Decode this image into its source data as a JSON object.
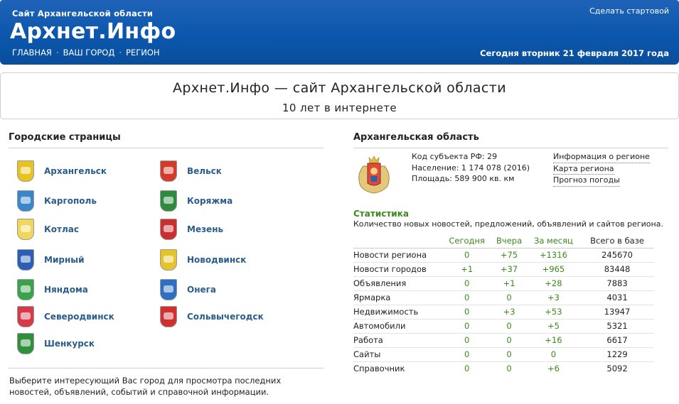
{
  "header": {
    "site_subtitle": "Сайт Архангельской области",
    "site_title": "Архнет.Инфо",
    "nav": [
      "ГЛАВНАЯ",
      "ВАШ ГОРОД",
      "РЕГИОН"
    ],
    "nav_sep": "·",
    "make_start": "Сделать стартовой",
    "today": "Сегодня вторник 21 февраля 2017 года"
  },
  "banner": {
    "title": "Архнет.Инфо — сайт Архангельской области",
    "subtitle": "10 лет в интернете"
  },
  "cities": {
    "title": "Городские страницы",
    "left": [
      {
        "name": "Архангельск",
        "icon": "arkhangelsk-crest-icon",
        "color": "#e8c21f"
      },
      {
        "name": "Каргополь",
        "icon": "kargopol-crest-icon",
        "color": "#3b86c8"
      },
      {
        "name": "Котлас",
        "icon": "kotlas-crest-icon",
        "color": "#f0d65a"
      },
      {
        "name": "Мирный",
        "icon": "mirny-crest-icon",
        "color": "#2a5fb5"
      },
      {
        "name": "Няндома",
        "icon": "nyandoma-crest-icon",
        "color": "#3aa24a"
      },
      {
        "name": "Северодвинск",
        "icon": "severodvinsk-crest-icon",
        "color": "#d43a4a"
      },
      {
        "name": "Шенкурск",
        "icon": "shenkursk-crest-icon",
        "color": "#2f8f3a"
      }
    ],
    "right": [
      {
        "name": "Вельск",
        "icon": "velsk-crest-icon",
        "color": "#d43a2a"
      },
      {
        "name": "Коряжма",
        "icon": "koryazhma-crest-icon",
        "color": "#2e8a3e"
      },
      {
        "name": "Мезень",
        "icon": "mezen-crest-icon",
        "color": "#c92f2f"
      },
      {
        "name": "Новодвинск",
        "icon": "novodvinsk-crest-icon",
        "color": "#e6c32a"
      },
      {
        "name": "Онега",
        "icon": "onega-crest-icon",
        "color": "#2f6fbf"
      },
      {
        "name": "Сольвычегодск",
        "icon": "solvychegodsk-crest-icon",
        "color": "#cf3030"
      }
    ],
    "footer": "Выберите интересующий Вас город для просмотра последних новостей, объявлений, событий и справочной информации."
  },
  "region": {
    "title": "Архангельская область",
    "crest_icon": "arkhangelsk-oblast-crest-icon",
    "code": "Код субъекта РФ: 29",
    "population": "Население: 1 174 078 (2016)",
    "area": "Площадь: 589 900 кв. км",
    "links": [
      "Информация о регионе",
      "Карта региона",
      "Прогноз погоды"
    ]
  },
  "stats": {
    "title": "Статистика",
    "description": "Количество новых новостей, предложений, объявлений и сайтов региона.",
    "headers": [
      "",
      "Сегодня",
      "Вчера",
      "За месяц",
      "Всего в базе"
    ],
    "rows": [
      [
        "Новости региона",
        "0",
        "+75",
        "+1316",
        "245670"
      ],
      [
        "Новости городов",
        "+1",
        "+37",
        "+965",
        "83448"
      ],
      [
        "Объявления",
        "0",
        "+1",
        "+28",
        "7883"
      ],
      [
        "Ярмарка",
        "0",
        "0",
        "+3",
        "4031"
      ],
      [
        "Недвижимость",
        "0",
        "+3",
        "+53",
        "13947"
      ],
      [
        "Автомобили",
        "0",
        "0",
        "+5",
        "5321"
      ],
      [
        "Работа",
        "0",
        "0",
        "+16",
        "6617"
      ],
      [
        "Сайты",
        "0",
        "0",
        "0",
        "1229"
      ],
      [
        "Справочник",
        "0",
        "0",
        "+6",
        "5092"
      ]
    ]
  }
}
